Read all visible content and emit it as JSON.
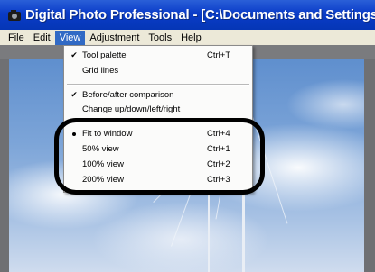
{
  "window": {
    "title": "Digital Photo Professional - [C:\\Documents and Settings\\XXXX"
  },
  "menubar": {
    "items": [
      {
        "label": "File",
        "active": false
      },
      {
        "label": "Edit",
        "active": false
      },
      {
        "label": "View",
        "active": true
      },
      {
        "label": "Adjustment",
        "active": false
      },
      {
        "label": "Tools",
        "active": false
      },
      {
        "label": "Help",
        "active": false
      }
    ]
  },
  "view_menu": {
    "items": [
      {
        "label": "Tool palette",
        "shortcut": "Ctrl+T",
        "checked": true
      },
      {
        "label": "Grid lines",
        "shortcut": "",
        "checked": false
      },
      {
        "label": "Before/after comparison",
        "shortcut": "",
        "checked": true
      },
      {
        "label": "Change up/down/left/right",
        "shortcut": "",
        "checked": false
      },
      {
        "label": "Fit to window",
        "shortcut": "Ctrl+4",
        "selected": true
      },
      {
        "label": "50% view",
        "shortcut": "Ctrl+1",
        "selected": false
      },
      {
        "label": "100% view",
        "shortcut": "Ctrl+2",
        "selected": false
      },
      {
        "label": "200% view",
        "shortcut": "Ctrl+3",
        "selected": false
      }
    ]
  },
  "icons": {
    "app": "camera-icon",
    "check": "check-icon",
    "radio": "radio-dot-icon"
  },
  "colors": {
    "titlebar": "#0a3cc8",
    "menu_active": "#316ac5",
    "menubar": "#ece9d8",
    "highlight_ring": "#000000"
  }
}
